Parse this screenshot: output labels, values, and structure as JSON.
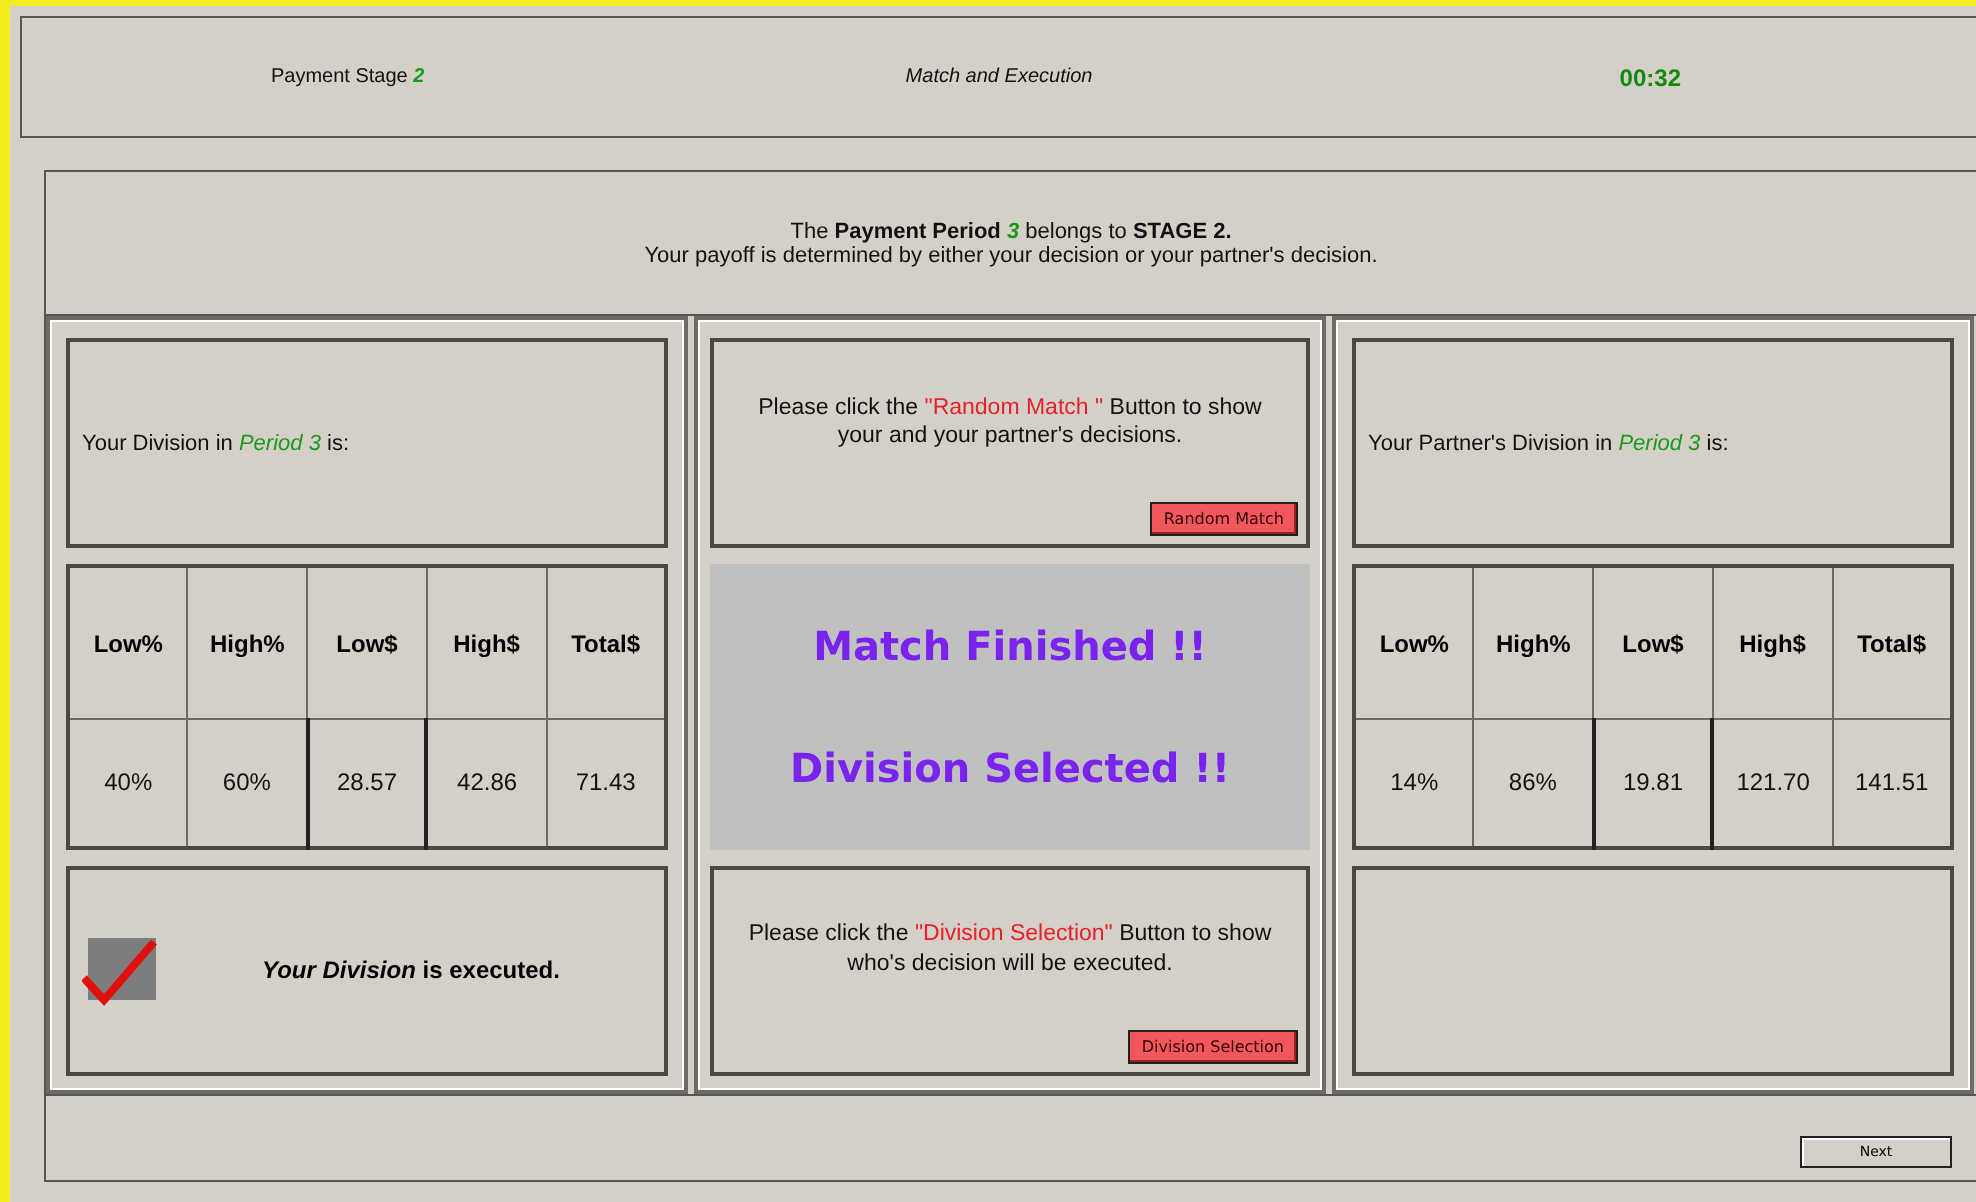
{
  "header": {
    "stage_label": "Payment Stage",
    "stage_number": "2",
    "title": "Match and Execution",
    "timer": "00:32"
  },
  "intro": {
    "line_1": "The **Payment Period** *3* belongs to **STAGE 2.**",
    "line_2": "Your payoff is determined by either your decision or your partner's decision."
  },
  "your_division": {
    "caption": "Your Division in *Period 3* is:",
    "columns": [
      "Low%",
      "High%",
      "Low$",
      "High$",
      "Total$"
    ],
    "values": [
      "40%",
      "60%",
      "28.57",
      "42.86",
      "71.43"
    ],
    "executed": true,
    "executed_text": "*Your Division* is executed."
  },
  "middle": {
    "match_prompt": {
      "before": "Please click the",
      "highlight": "\"Random Match \"",
      "after": "Button to show your and your partner's decisions."
    },
    "match_button": "Random Match",
    "messages": [
      "Match Finished !!",
      "Division Selected !!"
    ],
    "selection_prompt": {
      "before": "Please click the",
      "highlight": "\"Division Selection\"",
      "after": "Button to show who's decision will be executed."
    },
    "selection_button": "Division Selection"
  },
  "partner_division": {
    "caption": "Your Partner's Division in *Period 3* is:",
    "columns": [
      "Low%",
      "High%",
      "Low$",
      "High$",
      "Total$"
    ],
    "values": [
      "14%",
      "86%",
      "19.81",
      "121.70",
      "141.51"
    ],
    "executed": false
  },
  "footer": {
    "next_button": "Next"
  }
}
